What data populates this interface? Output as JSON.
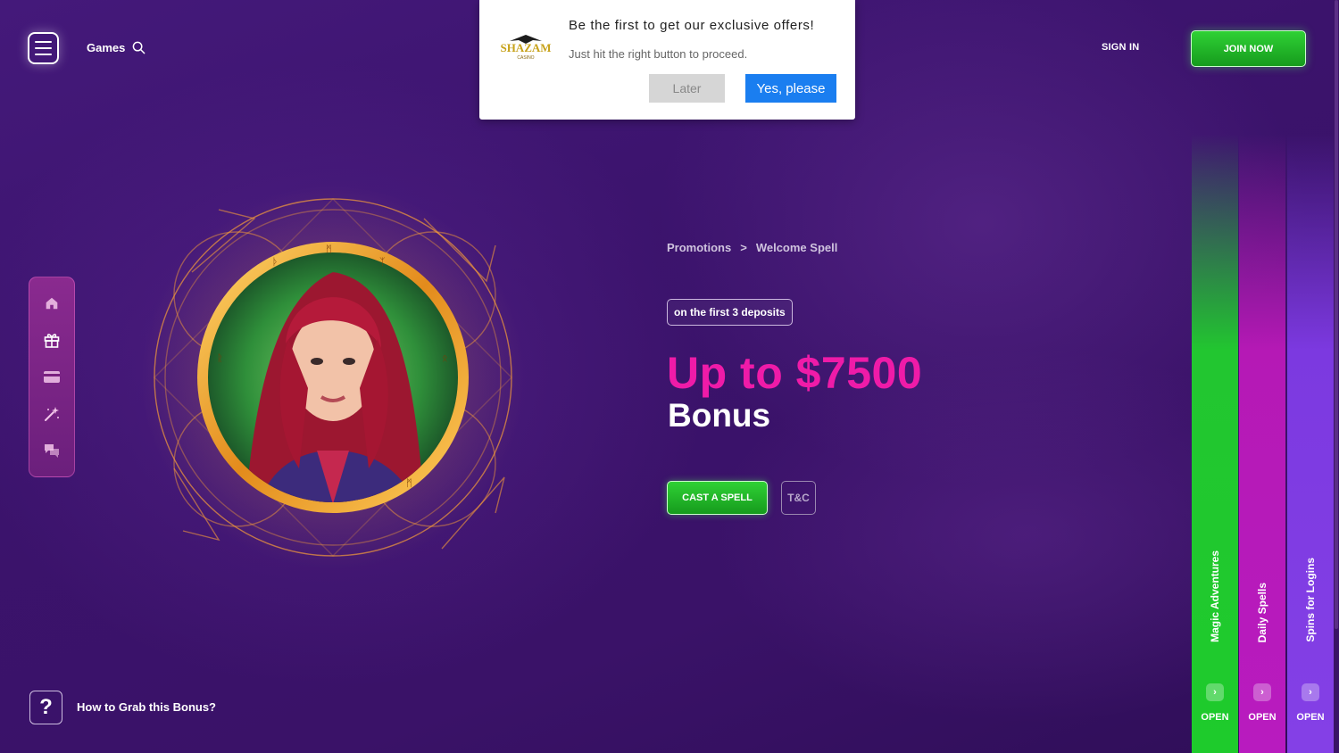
{
  "header": {
    "games_label": "Games",
    "signin_label": "SIGN IN",
    "join_label": "JOIN NOW"
  },
  "popup": {
    "logo_text": "SHAZAM",
    "logo_sub": "CASINO",
    "title": "Be the first to get our exclusive offers!",
    "message": "Just hit the right button to proceed.",
    "later_label": "Later",
    "yes_label": "Yes, please"
  },
  "sidebar": {
    "items": [
      {
        "icon": "home-icon"
      },
      {
        "icon": "gift-icon"
      },
      {
        "icon": "card-icon"
      },
      {
        "icon": "magic-wand-icon"
      },
      {
        "icon": "chat-icon"
      }
    ]
  },
  "breadcrumb": {
    "parent": "Promotions",
    "separator": ">",
    "current": "Welcome Spell"
  },
  "promo": {
    "badge": "on the first 3 deposits",
    "headline": "Up to $7500",
    "subhead": "Bonus",
    "cta_label": "CAST A SPELL",
    "tc_label": "T&C"
  },
  "help": {
    "icon_text": "?",
    "label": "How to Grab this Bonus?"
  },
  "right_tabs": [
    {
      "label": "Magic Adventures",
      "open": "OPEN",
      "color": "#22c630"
    },
    {
      "label": "Daily Spells",
      "open": "OPEN",
      "color": "#b519b5"
    },
    {
      "label": "Spins for Logins",
      "open": "OPEN",
      "color": "#7c39e0"
    }
  ],
  "colors": {
    "accent_pink": "#ef1ba8",
    "accent_green": "#22c630",
    "popup_yes": "#1a7ef0"
  }
}
